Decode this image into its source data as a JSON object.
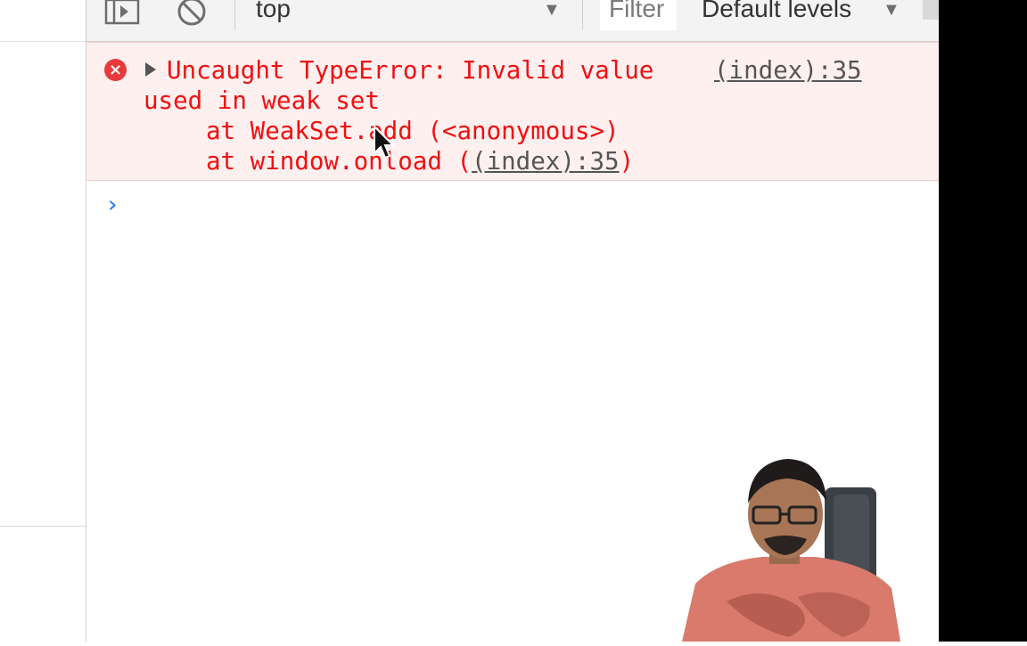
{
  "toolbar": {
    "context_value": "top",
    "filter_placeholder": "Filter",
    "levels_label": "Default levels"
  },
  "console": {
    "error": {
      "line1": "Uncaught TypeError: Invalid value",
      "source1": "(index):35",
      "line2": "used in weak set",
      "stack1": "at WeakSet.add (<anonymous>)",
      "stack2_prefix": "at window.onload (",
      "stack2_link": "(index):35",
      "stack2_suffix": ")"
    },
    "prompt_symbol": "›"
  },
  "colors": {
    "error_text": "#f01010",
    "error_bg": "#fff0f0",
    "prompt": "#1a73e8"
  },
  "icons": [
    "sidebar-toggle-icon",
    "clear-console-icon",
    "dropdown-caret-icon",
    "error-icon",
    "expand-triangle-icon",
    "mouse-cursor-icon"
  ]
}
